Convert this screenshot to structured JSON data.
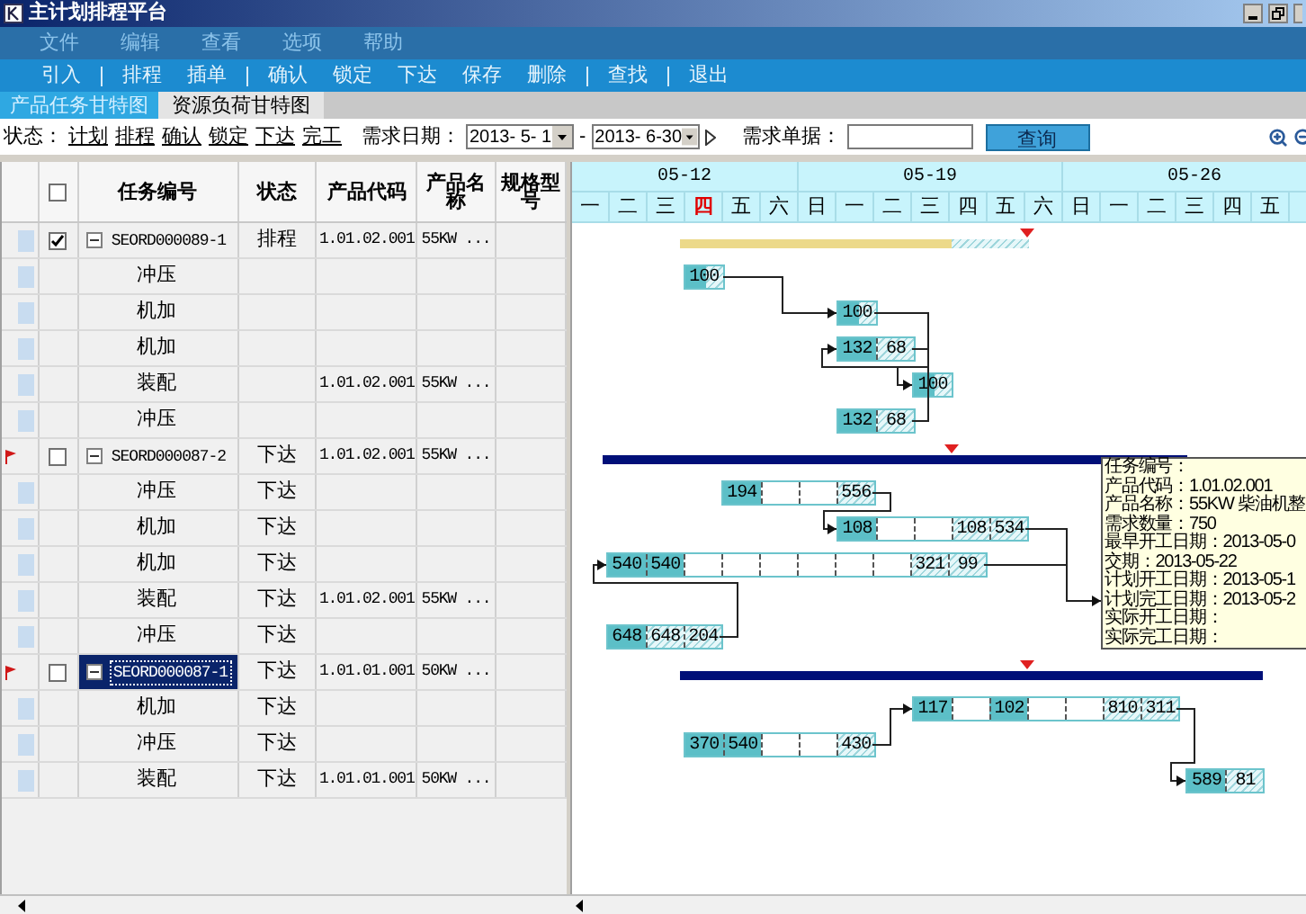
{
  "window": {
    "title": "主计划排程平台"
  },
  "menu": [
    "文件",
    "编辑",
    "查看",
    "选项",
    "帮助"
  ],
  "toolbar": [
    [
      "引入"
    ],
    [
      "排程",
      "插单"
    ],
    [
      "确认",
      "锁定",
      "下达",
      "保存",
      "删除"
    ],
    [
      "查找"
    ],
    [
      "退出"
    ]
  ],
  "tabs": [
    {
      "label": "产品任务甘特图",
      "selected": true
    },
    {
      "label": "资源负荷甘特图",
      "selected": false
    }
  ],
  "filter": {
    "status_label": "状态：",
    "statuses": [
      "计划",
      "排程",
      "确认",
      "锁定",
      "下达",
      "完工"
    ],
    "date_label": "需求日期：",
    "date_from": "2013- 5- 1",
    "date_sep": "-",
    "date_to": "2013- 6-30",
    "doc_label": "需求单据：",
    "search_button": "查询"
  },
  "table": {
    "columns": [
      "任务编号",
      "状态",
      "产品代码",
      "产品名称",
      "规格型号"
    ],
    "select_all_checked": false,
    "tasks": [
      {
        "flagged": false,
        "checked": true,
        "expanded": true,
        "selected": false,
        "id": "SEORD000089-1",
        "status": "排程",
        "product_code": "1.01.02.001",
        "product_name": "55KW ...",
        "summary": {
          "color": "#ecd98a",
          "level": 0.78
        },
        "children": [
          {
            "name": "冲压",
            "bar": [
              {
                "text": "100",
                "kind": "partial"
              }
            ]
          },
          {
            "name": "机加",
            "bar": [
              {
                "text": "100",
                "kind": "partial"
              }
            ]
          },
          {
            "name": "机加",
            "bar": [
              {
                "text": "132",
                "kind": "filled"
              },
              {
                "text": "68",
                "kind": "hatched"
              }
            ]
          },
          {
            "name": "装配",
            "product_code": "1.01.02.001",
            "product_name": "55KW ...",
            "bar": [
              {
                "text": "100",
                "kind": "partial"
              }
            ]
          },
          {
            "name": "冲压",
            "bar": [
              {
                "text": "132",
                "kind": "filled"
              },
              {
                "text": "68",
                "kind": "hatched"
              }
            ]
          }
        ]
      },
      {
        "flagged": true,
        "checked": false,
        "expanded": true,
        "selected": false,
        "id": "SEORD000087-2",
        "status": "下达",
        "product_code": "1.01.02.001",
        "product_name": "55KW ...",
        "summary": {
          "color": "#000f78",
          "level": 1
        },
        "children": [
          {
            "name": "冲压",
            "status": "下达",
            "bar": [
              {
                "text": "194",
                "kind": "filled"
              },
              {
                "kind": "empty"
              },
              {
                "kind": "empty"
              },
              {
                "text": "556",
                "kind": "hatched"
              }
            ]
          },
          {
            "name": "机加",
            "status": "下达",
            "bar": [
              {
                "text": "108",
                "kind": "filled"
              },
              {
                "kind": "empty"
              },
              {
                "kind": "empty"
              },
              {
                "text": "108",
                "kind": "hatched"
              },
              {
                "text": "534",
                "kind": "hatched"
              }
            ]
          },
          {
            "name": "机加",
            "status": "下达",
            "bar": [
              {
                "text": "540",
                "kind": "filled"
              },
              {
                "text": "540",
                "kind": "filled"
              },
              {
                "kind": "empty"
              },
              {
                "kind": "empty"
              },
              {
                "kind": "empty"
              },
              {
                "kind": "empty"
              },
              {
                "kind": "empty"
              },
              {
                "kind": "empty"
              },
              {
                "text": "321",
                "kind": "hatched"
              },
              {
                "text": "99",
                "kind": "hatched"
              }
            ]
          },
          {
            "name": "装配",
            "status": "下达",
            "product_code": "1.01.02.001",
            "product_name": "55KW ..."
          },
          {
            "name": "冲压",
            "status": "下达",
            "bar": [
              {
                "text": "648",
                "kind": "filled"
              },
              {
                "text": "648",
                "kind": "hatched"
              },
              {
                "text": "204",
                "kind": "hatched"
              }
            ]
          }
        ]
      },
      {
        "flagged": true,
        "checked": false,
        "expanded": true,
        "selected": true,
        "id": "SEORD000087-1",
        "status": "下达",
        "product_code": "1.01.01.001",
        "product_name": "50KW ...",
        "summary": {
          "color": "#000f78",
          "level": 1
        },
        "children": [
          {
            "name": "机加",
            "status": "下达",
            "bar": [
              {
                "text": "117",
                "kind": "filled"
              },
              {
                "kind": "empty"
              },
              {
                "text": "102",
                "kind": "filled"
              },
              {
                "kind": "empty"
              },
              {
                "kind": "empty"
              },
              {
                "text": "810",
                "kind": "hatched"
              },
              {
                "text": "311",
                "kind": "hatched"
              }
            ]
          },
          {
            "name": "冲压",
            "status": "下达",
            "bar": [
              {
                "text": "370",
                "kind": "filled"
              },
              {
                "text": "540",
                "kind": "filled"
              },
              {
                "kind": "empty"
              },
              {
                "kind": "empty"
              },
              {
                "text": "430",
                "kind": "hatched"
              }
            ]
          },
          {
            "name": "装配",
            "status": "下达",
            "product_code": "1.01.01.001",
            "product_name": "50KW ...",
            "bar": [
              {
                "text": "589",
                "kind": "filled"
              },
              {
                "text": "81",
                "kind": "hatched"
              }
            ]
          }
        ]
      }
    ]
  },
  "gantt": {
    "weeks": [
      "05-12",
      "05-19",
      "05-26"
    ],
    "days": [
      {
        "label": "一",
        "today": false
      },
      {
        "label": "二",
        "today": false
      },
      {
        "label": "三",
        "today": false
      },
      {
        "label": "四",
        "today": true
      },
      {
        "label": "五",
        "today": false
      },
      {
        "label": "六",
        "today": false
      },
      {
        "label": "日",
        "today": false
      },
      {
        "label": "一",
        "today": false
      },
      {
        "label": "二",
        "today": false
      },
      {
        "label": "三",
        "today": false
      },
      {
        "label": "四",
        "today": false
      },
      {
        "label": "五",
        "today": false
      },
      {
        "label": "六",
        "today": false
      },
      {
        "label": "日",
        "today": false
      },
      {
        "label": "一",
        "today": false
      },
      {
        "label": "二",
        "today": false
      },
      {
        "label": "三",
        "today": false
      },
      {
        "label": "四",
        "today": false
      },
      {
        "label": "五",
        "today": false
      }
    ],
    "tooltip": [
      "任务编号：",
      "产品代码：1.01.02.001",
      "产品名称：55KW 柴油机整",
      "需求数量：750",
      "最早开工日期：2013-05-0",
      "交期：2013-05-22",
      "计划开工日期：2013-05-1",
      "计划完工日期：2013-05-2",
      "实际开工日期：",
      "实际完工日期："
    ]
  }
}
